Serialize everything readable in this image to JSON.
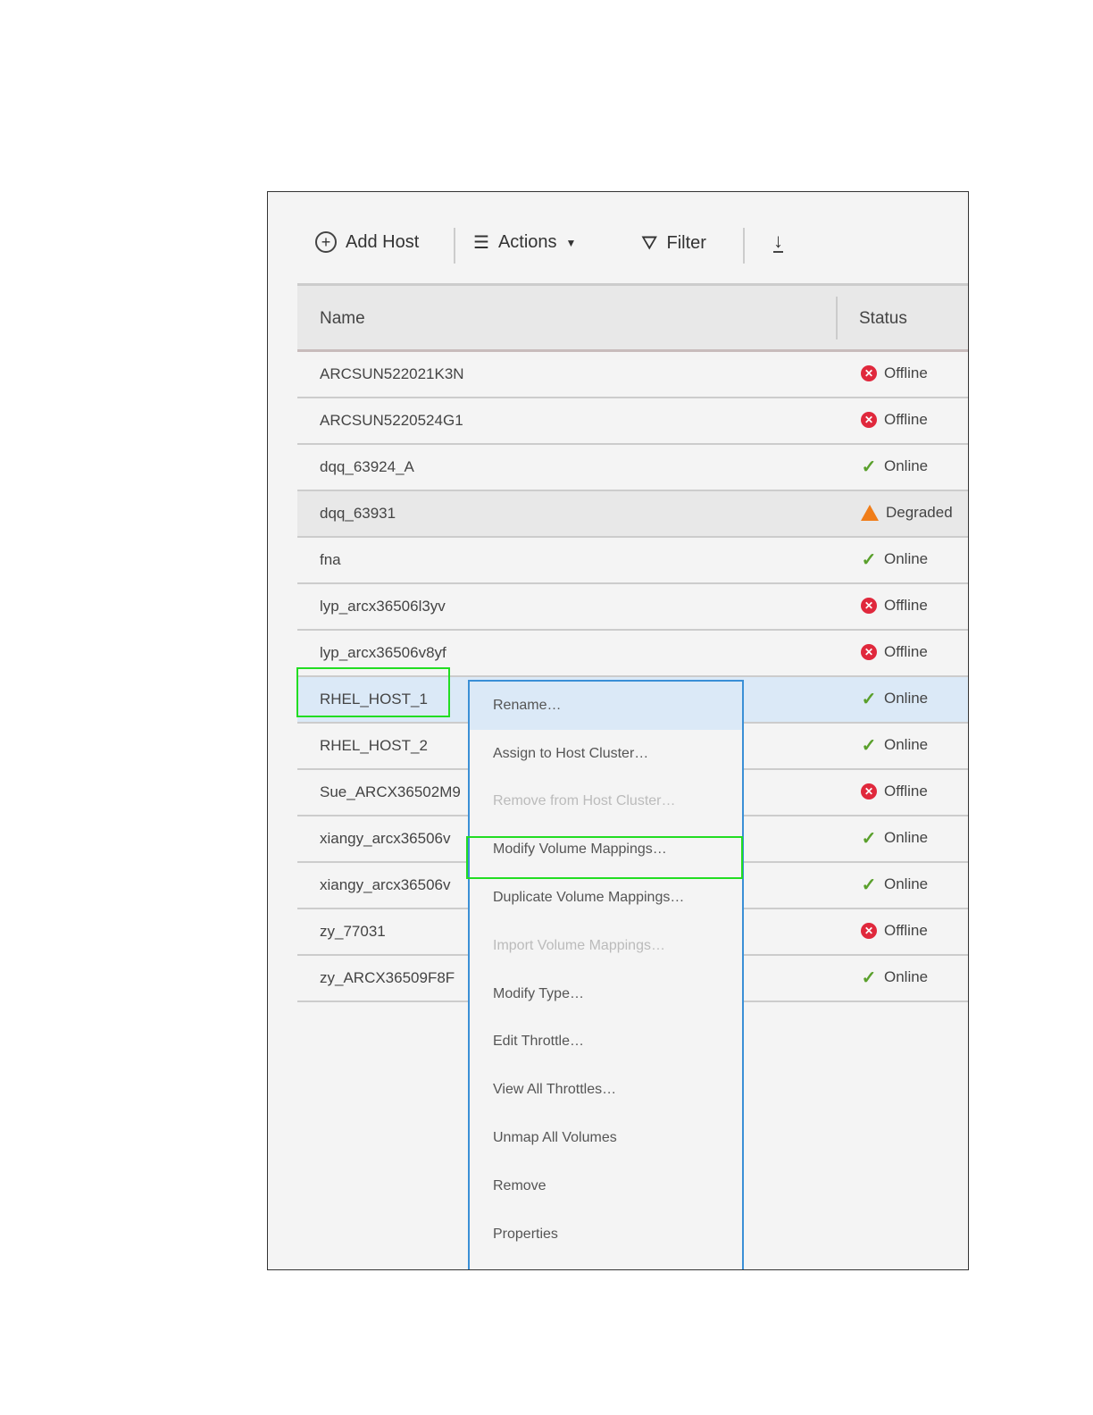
{
  "toolbar": {
    "add_host": "Add Host",
    "actions": "Actions",
    "filter": "Filter"
  },
  "columns": {
    "name": "Name",
    "status": "Status"
  },
  "rows": [
    {
      "name": "ARCSUN522021K3N",
      "status": "Offline"
    },
    {
      "name": "ARCSUN5220524G1",
      "status": "Offline"
    },
    {
      "name": "dqq_63924_A",
      "status": "Online"
    },
    {
      "name": "dqq_63931",
      "status": "Degraded"
    },
    {
      "name": "fna",
      "status": "Online"
    },
    {
      "name": "lyp_arcx36506l3yv",
      "status": "Offline"
    },
    {
      "name": "lyp_arcx36506v8yf",
      "status": "Offline"
    },
    {
      "name": "RHEL_HOST_1",
      "status": "Online"
    },
    {
      "name": "RHEL_HOST_2",
      "status": "Online"
    },
    {
      "name": "Sue_ARCX36502M9",
      "status": "Offline"
    },
    {
      "name": "xiangy_arcx36506v",
      "status": "Online"
    },
    {
      "name": "xiangy_arcx36506v",
      "status": "Online"
    },
    {
      "name": "zy_77031",
      "status": "Offline"
    },
    {
      "name": "zy_ARCX36509F8F",
      "status": "Online"
    }
  ],
  "menu": [
    {
      "label": "Rename…",
      "state": "hover"
    },
    {
      "label": "Assign to Host Cluster…",
      "state": "enabled"
    },
    {
      "label": "Remove from Host Cluster…",
      "state": "disabled"
    },
    {
      "label": "Modify Volume Mappings…",
      "state": "enabled"
    },
    {
      "label": "Duplicate Volume Mappings…",
      "state": "enabled"
    },
    {
      "label": "Import Volume Mappings…",
      "state": "disabled"
    },
    {
      "label": "Modify Type…",
      "state": "enabled"
    },
    {
      "label": "Edit Throttle…",
      "state": "enabled"
    },
    {
      "label": "View All Throttles…",
      "state": "enabled"
    },
    {
      "label": "Unmap All Volumes",
      "state": "enabled"
    },
    {
      "label": "Remove",
      "state": "enabled"
    },
    {
      "label": "Properties",
      "state": "enabled"
    }
  ]
}
